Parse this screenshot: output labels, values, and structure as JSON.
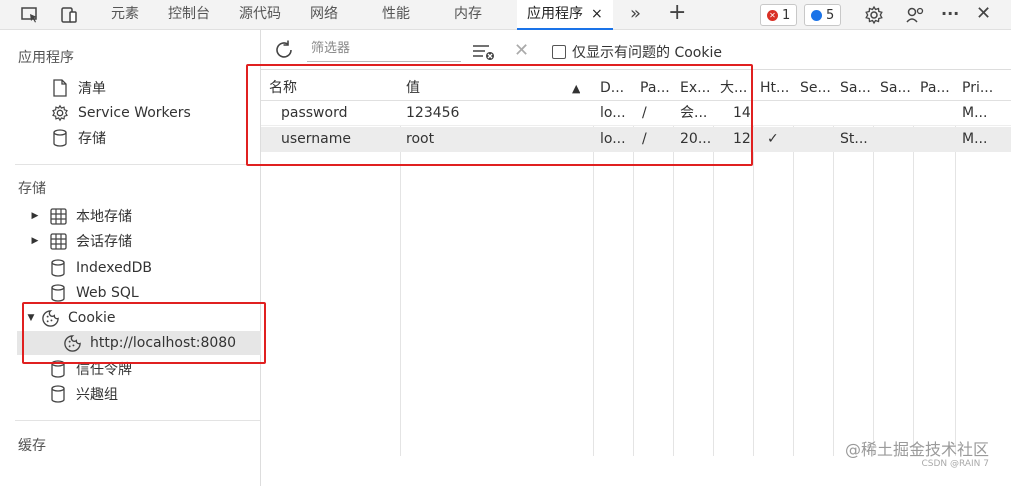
{
  "topbar": {
    "tabs": [
      "元素",
      "控制台",
      "源代码",
      "网络",
      "性能",
      "内存"
    ],
    "active_tab": "应用程序",
    "close_glyph": "×",
    "more_glyph": "»",
    "add_glyph": "+",
    "error_count": "1",
    "message_count": "5",
    "ellipsis": "···",
    "window_close": "✕"
  },
  "sidebar": {
    "app_section": "应用程序",
    "app_items": [
      "清单",
      "Service Workers",
      "存储"
    ],
    "storage_section": "存储",
    "storage_items": [
      "本地存储",
      "会话存储",
      "IndexedDB",
      "Web SQL",
      "Cookie",
      "http://localhost:8080",
      "信任令牌",
      "兴趣组"
    ],
    "cache_section": "缓存"
  },
  "toolbar": {
    "filter_placeholder": "筛选器",
    "only_issues_label": "仅显示有问题的 Cookie"
  },
  "table": {
    "headers": [
      "名称",
      "值",
      "D...",
      "Pa...",
      "Ex...",
      "大...",
      "Ht...",
      "Se...",
      "Sa...",
      "Sa...",
      "Pa...",
      "Pri..."
    ],
    "sort_indicator": "▲",
    "rows": [
      [
        "password",
        "123456",
        "lo...",
        "/",
        "会...",
        "14",
        "",
        "",
        "",
        "",
        "",
        "M..."
      ],
      [
        "username",
        "root",
        "lo...",
        "/",
        "20...",
        "12",
        "✓",
        "",
        "St...",
        "",
        "",
        "M..."
      ]
    ]
  },
  "watermark": {
    "main": "@稀土掘金技术社区",
    "sub": "CSDN @RAIN 7"
  },
  "colors": {
    "highlight": "#e02020",
    "accent": "#1a73e8",
    "error": "#d93025",
    "message": "#1a73e8"
  }
}
